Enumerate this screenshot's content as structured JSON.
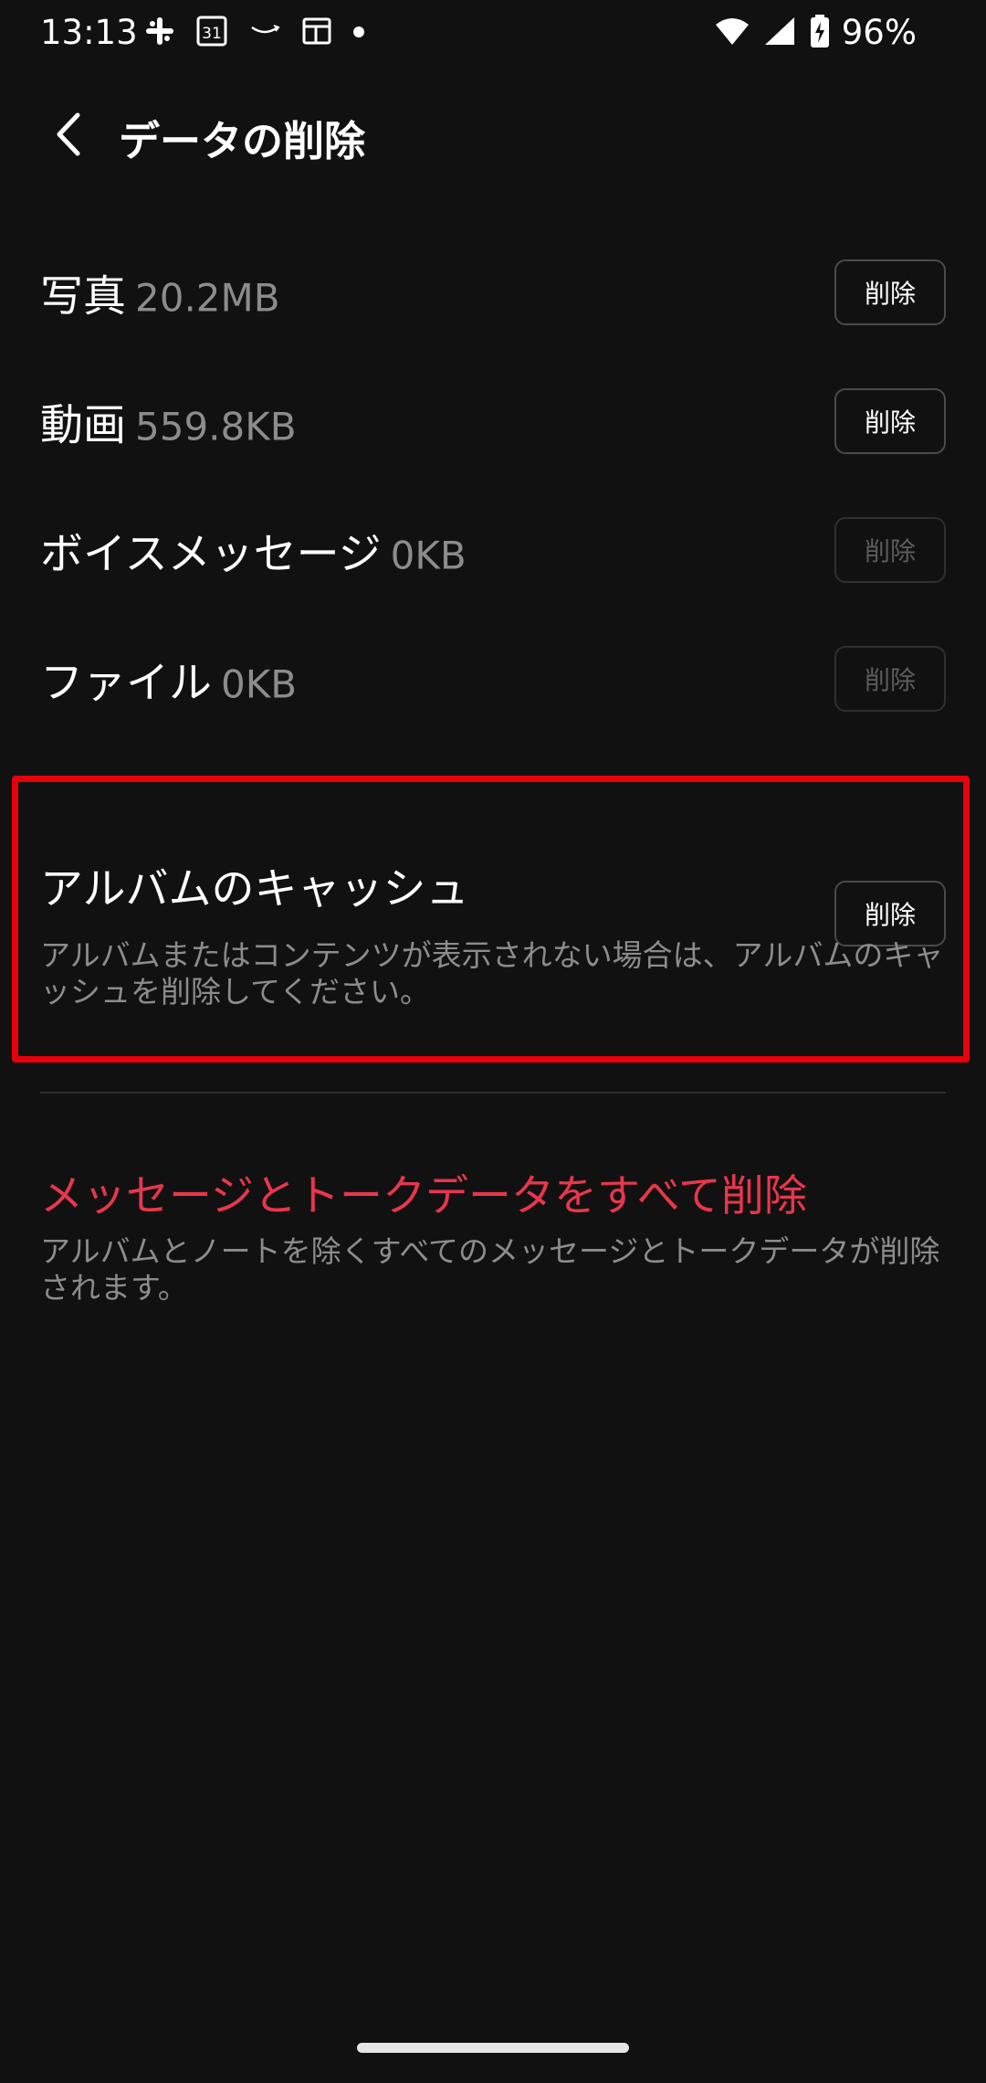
{
  "status_bar": {
    "time": "13:13",
    "battery": "96%",
    "icons_left": [
      "slack-icon",
      "calendar-icon",
      "amazon-icon",
      "news-icon",
      "dot-icon"
    ],
    "calendar_day": "31",
    "icons_right": [
      "wifi-icon",
      "signal-icon",
      "battery-charging-icon"
    ]
  },
  "header": {
    "title": "データの削除",
    "back_icon": "chevron-left-icon"
  },
  "items": [
    {
      "label": "写真",
      "size": "20.2MB",
      "button": "削除",
      "enabled": true
    },
    {
      "label": "動画",
      "size": "559.8KB",
      "button": "削除",
      "enabled": true
    },
    {
      "label": "ボイスメッセージ",
      "size": "0KB",
      "button": "削除",
      "enabled": false
    },
    {
      "label": "ファイル",
      "size": "0KB",
      "button": "削除",
      "enabled": false
    }
  ],
  "album_cache": {
    "title": "アルバムのキャッシュ",
    "button": "削除",
    "description": "アルバムまたはコンテンツが表示されない場合は、アルバムのキャッシュを削除してください。"
  },
  "delete_all": {
    "title": "メッセージとトークデータをすべて削除",
    "description": "アルバムとノートを除くすべてのメッセージとトークデータが削除されます。"
  },
  "colors": {
    "background": "#111111",
    "highlight_border": "#e8000b",
    "danger_text": "#e8364d",
    "secondary_text": "#8c8c8c"
  }
}
